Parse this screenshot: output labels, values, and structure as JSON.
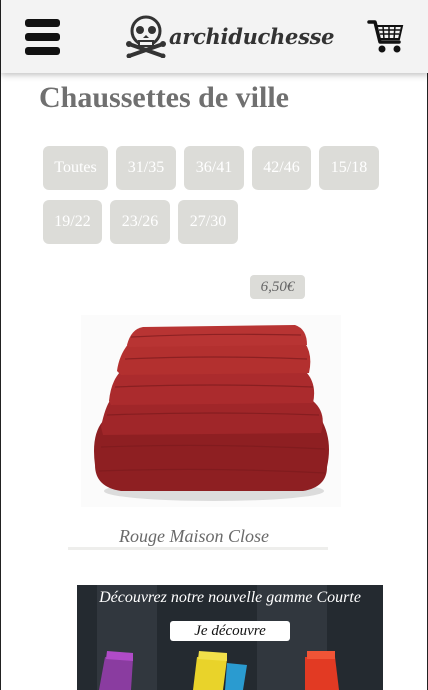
{
  "header": {
    "brand": "archiduchesse",
    "menu_icon": "hamburger-menu-icon",
    "cart_icon": "shopping-cart-icon"
  },
  "page": {
    "title": "Chaussettes de ville"
  },
  "filters": [
    "Toutes",
    "31/35",
    "36/41",
    "42/46",
    "15/18",
    "19/22",
    "23/26",
    "27/30"
  ],
  "product": {
    "price": "6,50€",
    "name": "Rouge Maison Close",
    "color": "#a8282a"
  },
  "banner": {
    "headline": "Découvrez notre nouvelle gamme Courte",
    "cta": "Je découvre"
  }
}
